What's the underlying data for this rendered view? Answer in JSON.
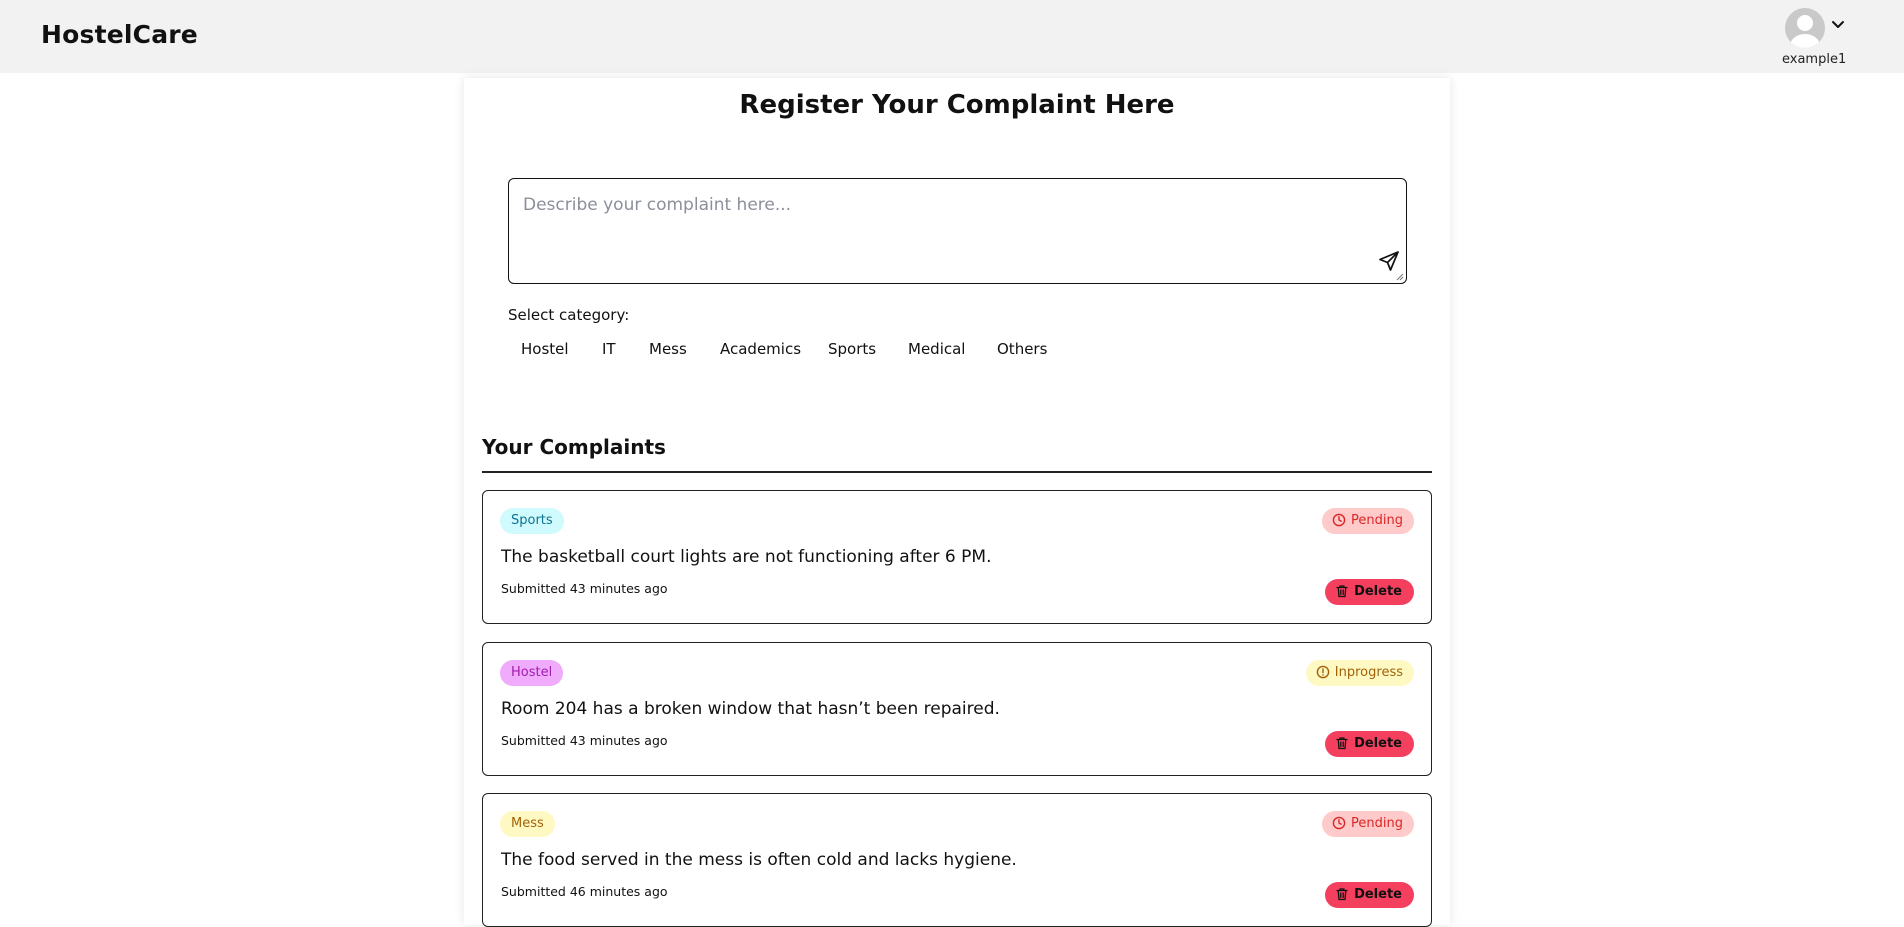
{
  "app": {
    "brand": "HostelCare",
    "username": "example1"
  },
  "form": {
    "title": "Register Your Complaint Here",
    "placeholder": "Describe your complaint here...",
    "category_label": "Select category:",
    "categories": [
      "Hostel",
      "IT",
      "Mess",
      "Academics",
      "Sports",
      "Medical",
      "Others"
    ]
  },
  "complaints_section": {
    "title": "Your Complaints",
    "delete_label": "Delete",
    "items": [
      {
        "category": "Sports",
        "status": "Pending",
        "text": "The basketball court lights are not functioning after 6 PM.",
        "submitted": "Submitted 43 minutes ago"
      },
      {
        "category": "Hostel",
        "status": "Inprogress",
        "text": "Room 204 has a broken window that hasn’t been repaired.",
        "submitted": "Submitted 43 minutes ago"
      },
      {
        "category": "Mess",
        "status": "Pending",
        "text": "The food served in the mess is often cold and lacks hygiene.",
        "submitted": "Submitted 46 minutes ago"
      }
    ]
  },
  "colors": {
    "tag_sports_bg": "#cffafe",
    "tag_sports_fg": "#0e7490",
    "tag_hostel_bg": "#f0abfc",
    "tag_hostel_fg": "#a21caf",
    "tag_mess_bg": "#fef9c3",
    "tag_mess_fg": "#a16207",
    "status_pending_bg": "#fecaca",
    "status_pending_fg": "#dc2626",
    "status_inprogress_bg": "#fef9c3",
    "status_inprogress_fg": "#a16207",
    "delete_bg": "#f43f5e"
  },
  "icons": {
    "avatar": "user-avatar-icon",
    "menu": "chevron-down-icon",
    "send": "send-icon",
    "pending": "clock-icon",
    "inprogress": "alert-circle-icon",
    "delete": "trash-icon"
  }
}
